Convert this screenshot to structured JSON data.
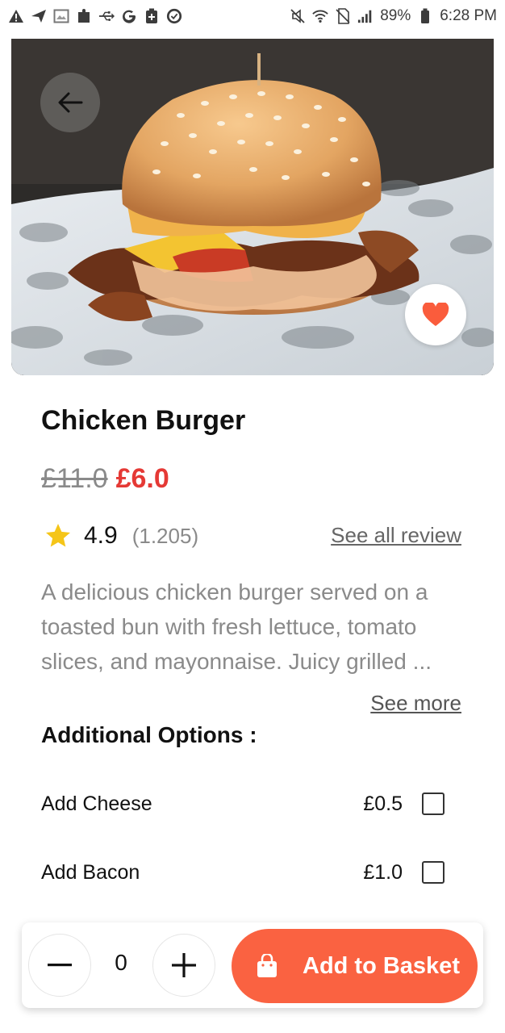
{
  "status_bar": {
    "battery_percent": "89%",
    "time": "6:28 PM"
  },
  "product": {
    "title": "Chicken Burger",
    "old_price": "£11.0",
    "new_price": "£6.0",
    "rating": "4.9",
    "rating_count": "(1.205)",
    "see_all_label": "See all review",
    "description": "A delicious chicken burger served on a toasted bun with fresh lettuce, tomato slices, and mayonnaise. Juicy grilled ...",
    "see_more_label": "See more",
    "favorite": true
  },
  "options": {
    "title": "Additional Options :",
    "items": [
      {
        "label": "Add Cheese",
        "price": "£0.5",
        "checked": false
      },
      {
        "label": "Add Bacon",
        "price": "£1.0",
        "checked": false
      }
    ]
  },
  "cart": {
    "quantity": "0",
    "add_label": "Add to Basket"
  },
  "colors": {
    "accent": "#fa6241",
    "sale_price": "#e53935",
    "star": "#f5c518",
    "heart": "#fa5c3c"
  },
  "icons": {
    "back": "arrow-left-icon",
    "favorite": "heart-icon",
    "rating": "star-icon",
    "minus": "minus-icon",
    "plus": "plus-icon",
    "basket": "shopping-bag-icon"
  }
}
